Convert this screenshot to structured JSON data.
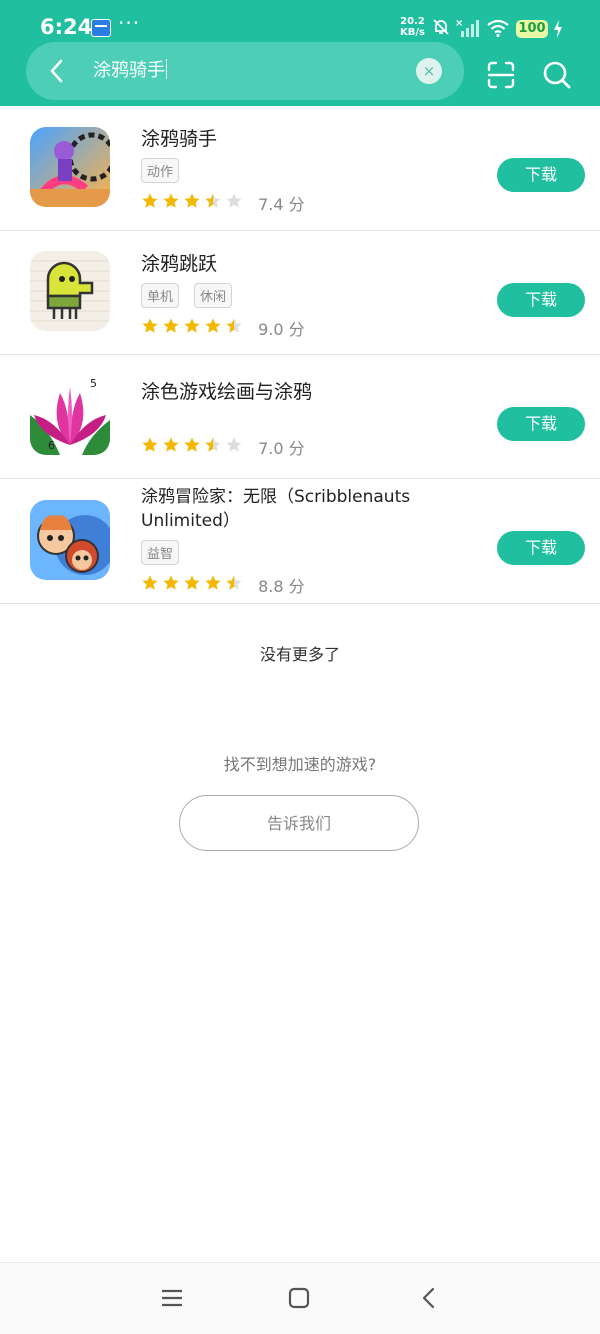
{
  "status_bar": {
    "time": "6:24",
    "dots": "···",
    "net_speed_value": "20.2",
    "net_speed_unit": "KB/s",
    "battery": "100"
  },
  "search": {
    "query": "涂鸦骑手",
    "clear_glyph": "×"
  },
  "apps": [
    {
      "name": "涂鸦骑手",
      "tags": [
        "动作"
      ],
      "stars": 3.5,
      "score": "7.4 分",
      "button": "下载"
    },
    {
      "name": "涂鸦跳跃",
      "tags": [
        "单机",
        "休闲"
      ],
      "stars": 4.5,
      "score": "9.0 分",
      "button": "下载"
    },
    {
      "name": "涂色游戏绘画与涂鸦",
      "tags": [],
      "stars": 3.5,
      "score": "7.0 分",
      "button": "下载"
    },
    {
      "name": "涂鸦冒险家：无限（Scribblenauts Unlimited）",
      "tags": [
        "益智"
      ],
      "stars": 4.5,
      "score": "8.8 分",
      "button": "下载"
    }
  ],
  "icon_numbers": {
    "top_right": "5",
    "bottom_left": "6"
  },
  "footer": {
    "no_more": "没有更多了",
    "not_found": "找不到想加速的游戏?",
    "tell_us": "告诉我们"
  },
  "colors": {
    "brand": "#1fbfa0",
    "star": "#f5b800",
    "star_empty": "#dddddd"
  },
  "icons": {
    "back": "chevron-left-icon",
    "clear": "clear-icon",
    "scan": "scan-icon",
    "search": "search-icon",
    "nav_menu": "menu-icon",
    "nav_home": "home-icon",
    "nav_back": "back-icon"
  }
}
